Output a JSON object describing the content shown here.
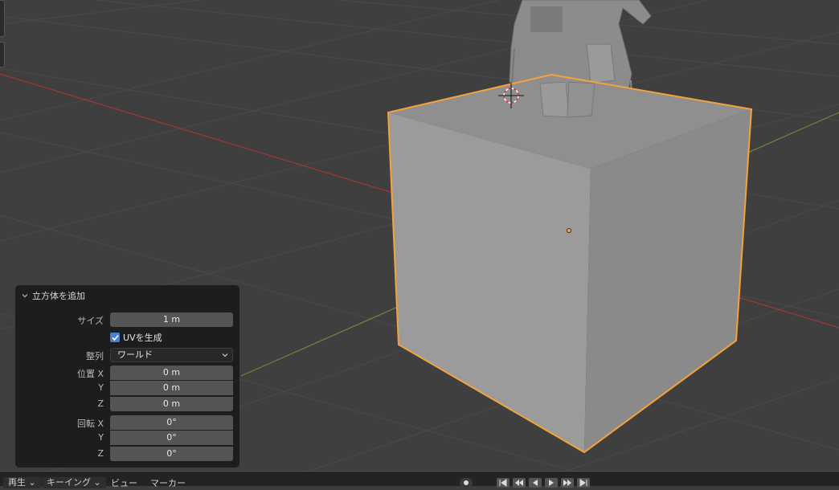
{
  "viewport": {
    "colors": {
      "background": "#3f3f3f",
      "grid": "#4a4a4a",
      "x_axis": "#a03838",
      "y_axis": "#6b8a3a",
      "selection": "#f5a23c",
      "cube_top": "#8f8f8f",
      "cube_left": "#9b9b9b",
      "cube_right": "#8a8a8a"
    },
    "icons": [
      "3d-cursor-icon",
      "origin-point-icon"
    ]
  },
  "operator_panel": {
    "title": "立方体を追加",
    "size_label": "サイズ",
    "size_value": "1 m",
    "generate_uv_label": "UVを生成",
    "generate_uv_checked": true,
    "align_label": "整列",
    "align_value": "ワールド",
    "location_label": "位置 X",
    "location_y_label": "Y",
    "location_z_label": "Z",
    "location_x": "0 m",
    "location_y": "0 m",
    "location_z": "0 m",
    "rotation_label": "回転 X",
    "rotation_y_label": "Y",
    "rotation_z_label": "Z",
    "rotation_x": "0°",
    "rotation_y": "0°",
    "rotation_z": "0°"
  },
  "timeline": {
    "playback_menu": "再生",
    "keying_menu": "キーイング",
    "view_menu": "ビュー",
    "marker_menu": "マーカー"
  }
}
